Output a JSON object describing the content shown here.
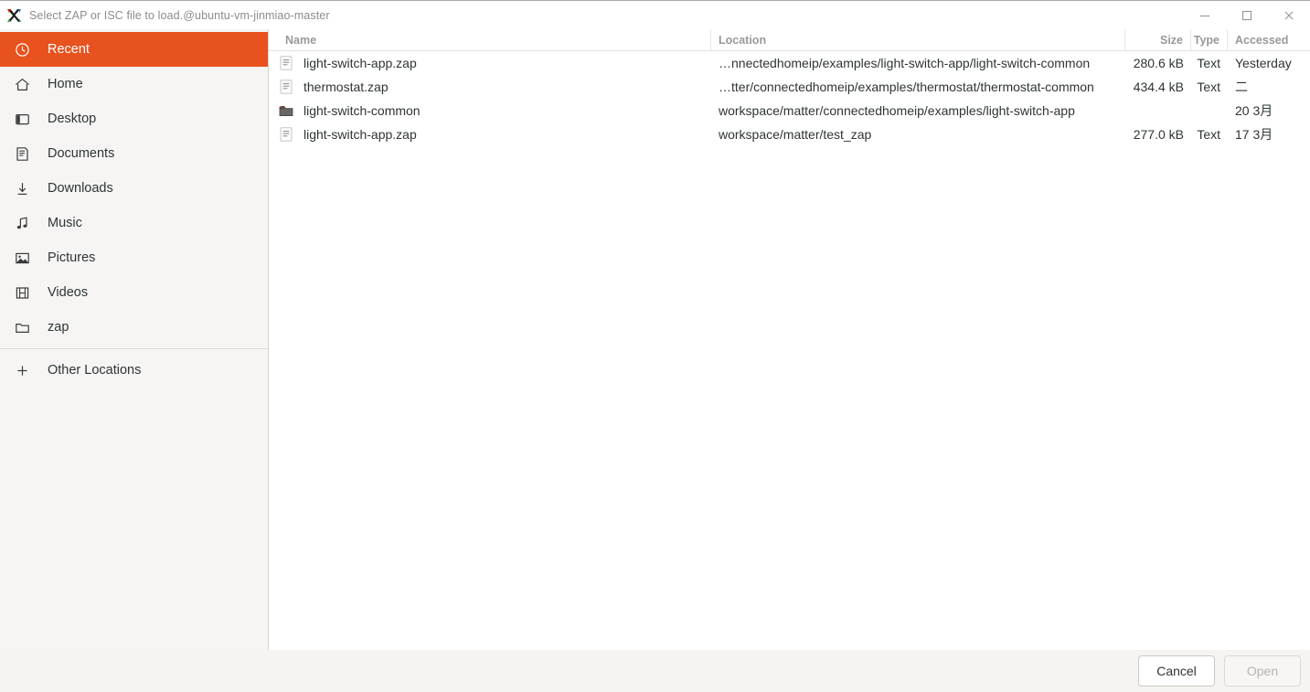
{
  "window": {
    "title": "Select ZAP or ISC file to load.@ubuntu-vm-jinmiao-master",
    "app_icon": "x-logo-icon",
    "controls": {
      "minimize": "minimize-icon",
      "maximize": "maximize-icon",
      "close": "close-icon"
    },
    "accent_color": "#e8521e",
    "sidebar_bg": "#f6f5f4",
    "footer_bg": "#f5f4f2"
  },
  "sidebar": {
    "items": [
      {
        "label": "Recent",
        "icon": "clock-icon",
        "active": true
      },
      {
        "label": "Home",
        "icon": "home-icon",
        "active": false
      },
      {
        "label": "Desktop",
        "icon": "desktop-icon",
        "active": false
      },
      {
        "label": "Documents",
        "icon": "document-icon",
        "active": false
      },
      {
        "label": "Downloads",
        "icon": "download-icon",
        "active": false
      },
      {
        "label": "Music",
        "icon": "music-icon",
        "active": false
      },
      {
        "label": "Pictures",
        "icon": "picture-icon",
        "active": false
      },
      {
        "label": "Videos",
        "icon": "video-icon",
        "active": false
      },
      {
        "label": "zap",
        "icon": "folder-icon",
        "active": false
      }
    ],
    "other_locations": {
      "label": "Other Locations",
      "icon": "plus-icon"
    }
  },
  "file_list": {
    "columns": [
      "Name",
      "Location",
      "Size",
      "Type",
      "Accessed"
    ],
    "rows": [
      {
        "icon": "text-file-icon",
        "name": "light-switch-app.zap",
        "location": "…nnectedhomeip/examples/light-switch-app/light-switch-common",
        "size": "280.6 kB",
        "type": "Text",
        "accessed": "Yesterday"
      },
      {
        "icon": "text-file-icon",
        "name": "thermostat.zap",
        "location": "…tter/connectedhomeip/examples/thermostat/thermostat-common",
        "size": "434.4 kB",
        "type": "Text",
        "accessed": "二"
      },
      {
        "icon": "folder-file-icon",
        "name": "light-switch-common",
        "location": "workspace/matter/connectedhomeip/examples/light-switch-app",
        "size": "",
        "type": "",
        "accessed": "20 3月"
      },
      {
        "icon": "text-file-icon",
        "name": "light-switch-app.zap",
        "location": "workspace/matter/test_zap",
        "size": "277.0 kB",
        "type": "Text",
        "accessed": "17 3月"
      }
    ]
  },
  "footer": {
    "cancel_label": "Cancel",
    "open_label": "Open"
  }
}
